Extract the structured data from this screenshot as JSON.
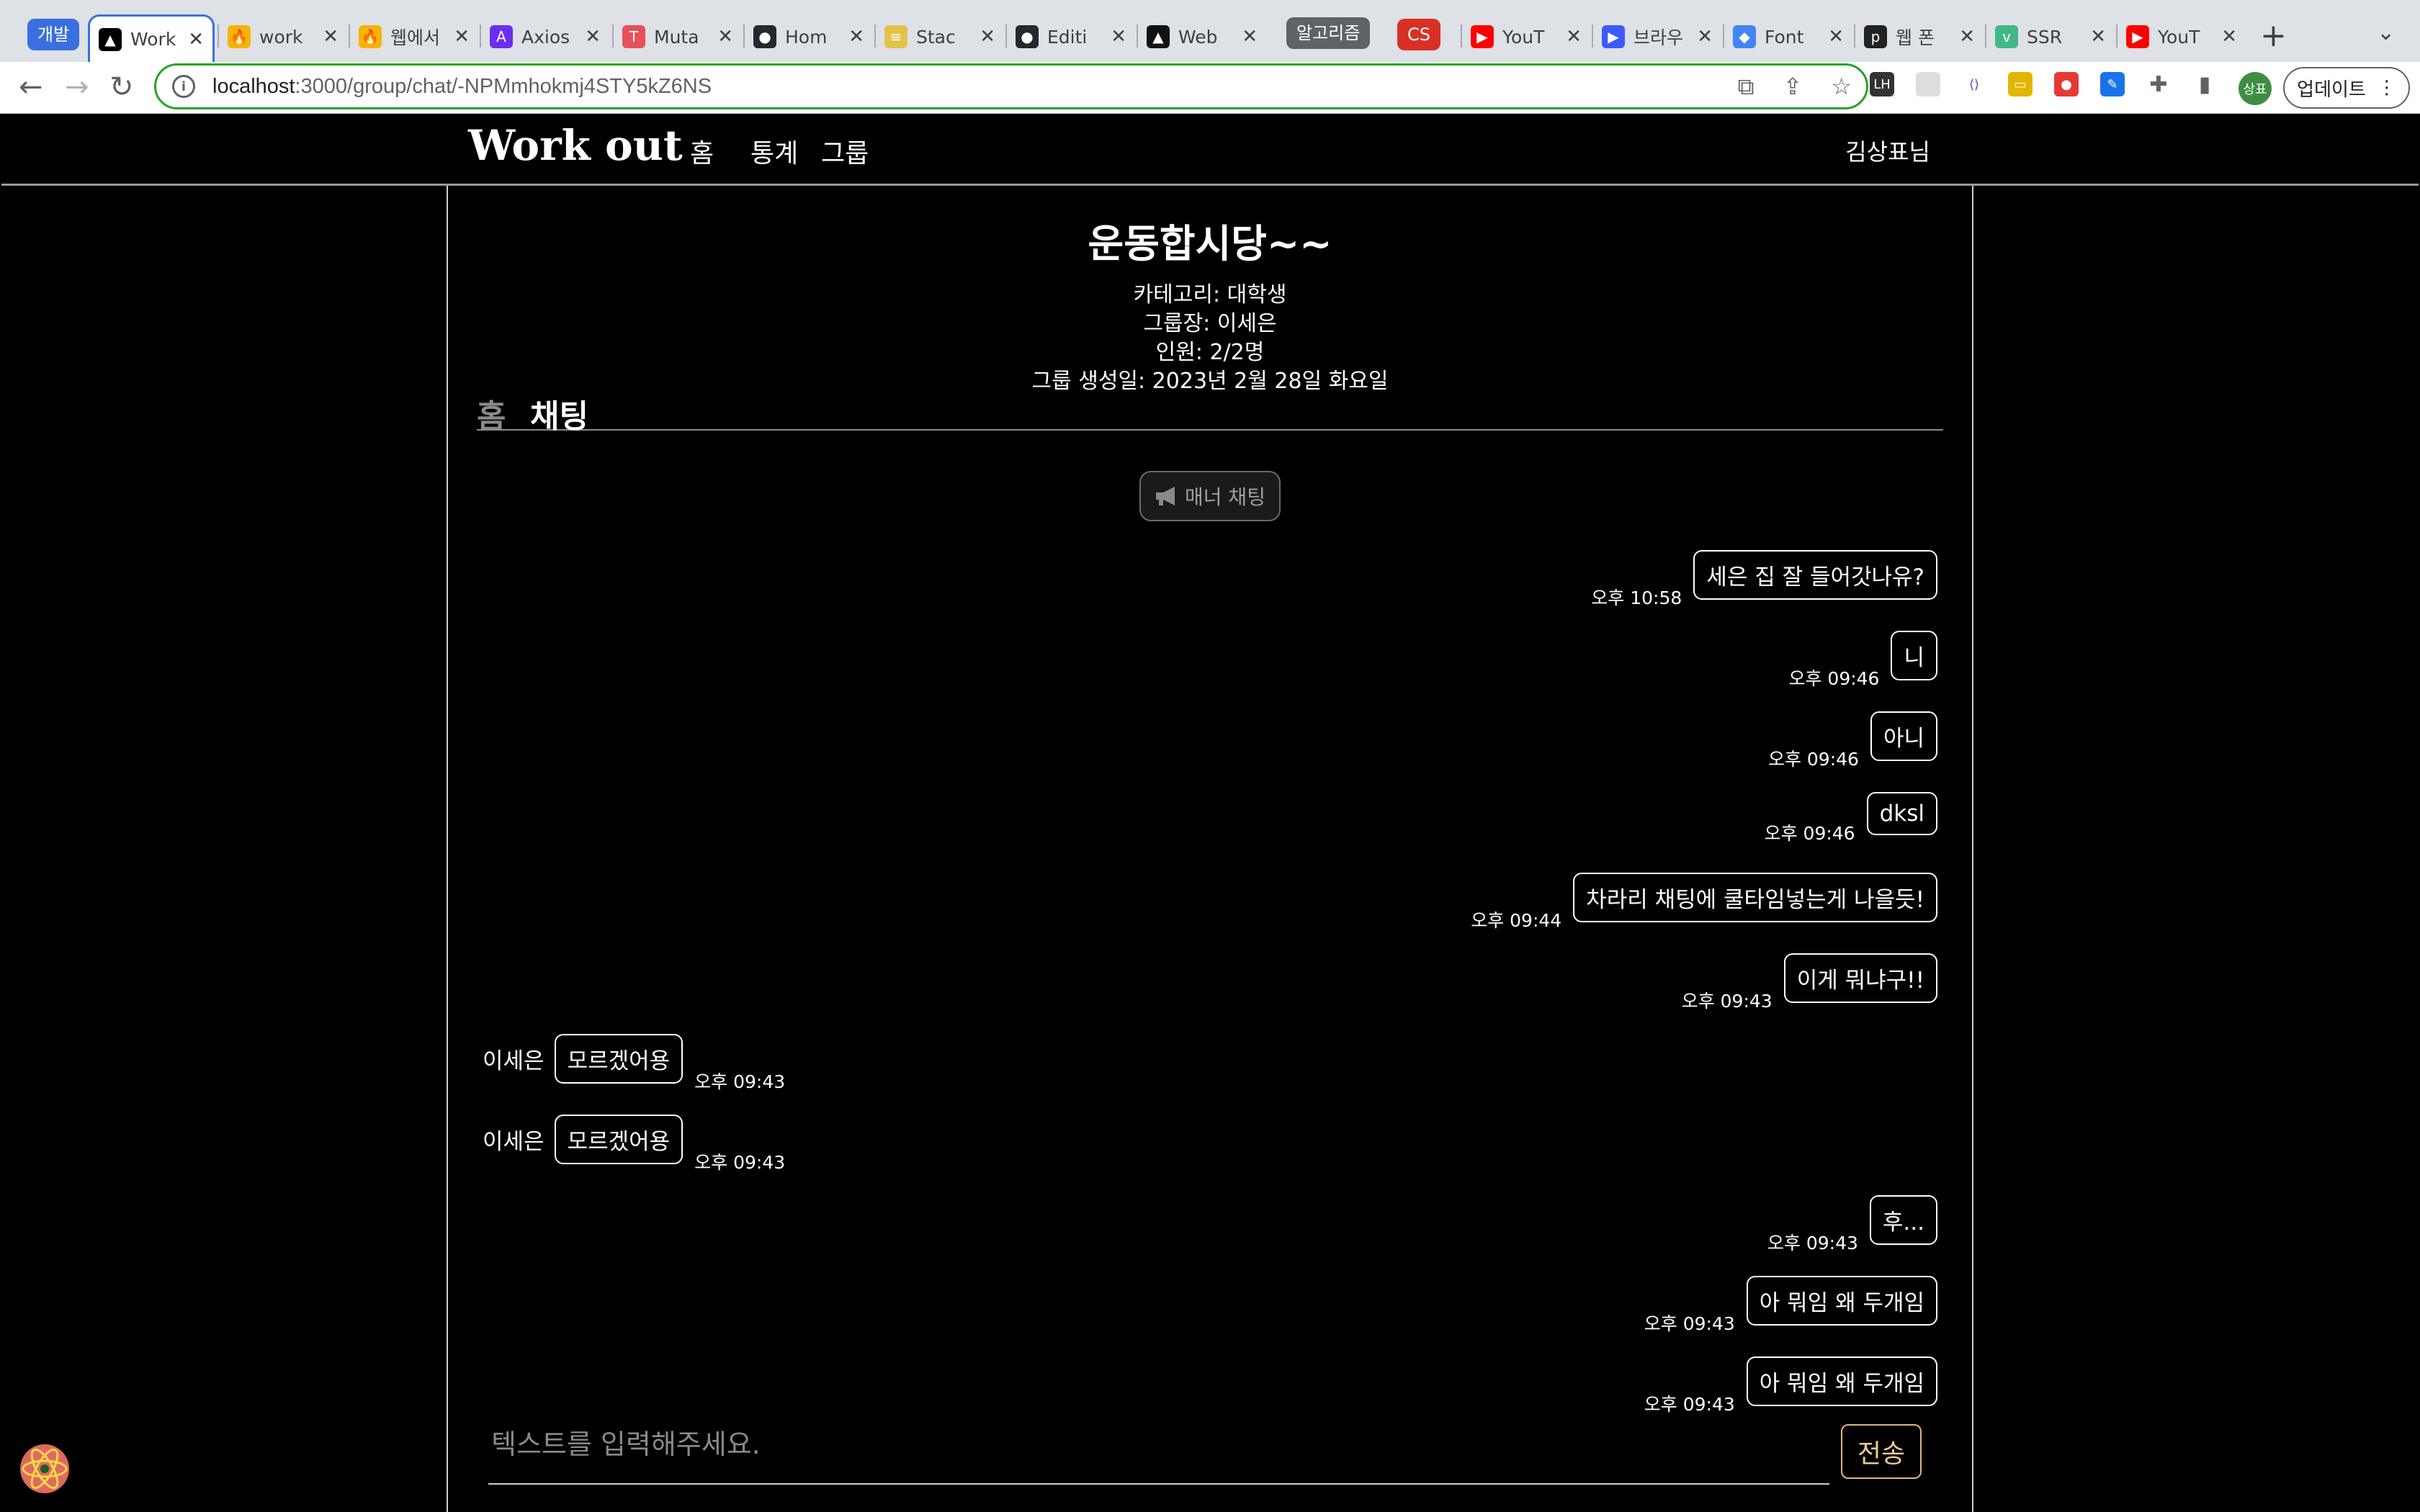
{
  "browser": {
    "tab_groups": [
      {
        "label": "개발",
        "color": "#3b6fe0"
      },
      {
        "label": "알고리즘",
        "color": "#5f6368"
      },
      {
        "label": "CS",
        "color": "#d93025"
      }
    ],
    "tabs": [
      {
        "title": "Work",
        "favicon_color": "#000000",
        "favicon": "▲"
      },
      {
        "title": "work",
        "favicon_color": "#f5b400",
        "favicon": "🔥"
      },
      {
        "title": "웹에서",
        "favicon_color": "#f5b400",
        "favicon": "🔥"
      },
      {
        "title": "Axios",
        "favicon_color": "#6b2ef0",
        "favicon": "A"
      },
      {
        "title": "Muta",
        "favicon_color": "#e8505b",
        "favicon": "T"
      },
      {
        "title": "Hom",
        "favicon_color": "#24292e",
        "favicon": "●"
      },
      {
        "title": "Stac",
        "favicon_color": "#e3c24a",
        "favicon": "≡"
      },
      {
        "title": "Editi",
        "favicon_color": "#24292e",
        "favicon": "●"
      },
      {
        "title": "Web",
        "favicon_color": "#111111",
        "favicon": "▲"
      },
      {
        "title": "YouT",
        "favicon_color": "#ff0000",
        "favicon": "▶"
      },
      {
        "title": "브라우",
        "favicon_color": "#3d5afe",
        "favicon": "▶"
      },
      {
        "title": "Font",
        "favicon_color": "#4285f4",
        "favicon": "◆"
      },
      {
        "title": "웹 폰",
        "favicon_color": "#222222",
        "favicon": "p"
      },
      {
        "title": "SSR",
        "favicon_color": "#41b883",
        "favicon": "v"
      },
      {
        "title": "YouT",
        "favicon_color": "#ff0000",
        "favicon": "▶"
      }
    ],
    "url_host": "localhost",
    "url_path": ":3000/group/chat/-NPMmhokmj4STY5kZ6NS",
    "profile_label": "상표",
    "update_label": "업데이트"
  },
  "site": {
    "brand": "Work out",
    "nav": [
      "홈",
      "통계",
      "그룹"
    ],
    "user": "김상표님"
  },
  "group": {
    "title": "운동합시당~~",
    "category": "카테고리: 대학생",
    "leader": "그룹장: 이세은",
    "members": "인원: 2/2명",
    "created": "그룹 생성일: 2023년 2월 28일 화요일"
  },
  "subtabs": {
    "home": "홈",
    "chat": "채팅"
  },
  "manner_button": "매너 채팅",
  "messages": [
    {
      "side": "mine",
      "text": "세은 집 잘 들어갓나유?",
      "time": "오후 10:58"
    },
    {
      "side": "mine",
      "text": "니",
      "time": "오후 09:46"
    },
    {
      "side": "mine",
      "text": "아니",
      "time": "오후 09:46"
    },
    {
      "side": "mine",
      "text": "dksl",
      "time": "오후 09:46"
    },
    {
      "side": "mine",
      "text": "차라리 채팅에 쿨타임넣는게 나을듯!",
      "time": "오후 09:44"
    },
    {
      "side": "mine",
      "text": "이게 뭐냐구!!",
      "time": "오후 09:43"
    },
    {
      "side": "theirs",
      "sender": "이세은",
      "text": "모르겠어용",
      "time": "오후 09:43"
    },
    {
      "side": "theirs",
      "sender": "이세은",
      "text": "모르겠어용",
      "time": "오후 09:43"
    },
    {
      "side": "mine",
      "text": "후...",
      "time": "오후 09:43"
    },
    {
      "side": "mine",
      "text": "아 뭐임 왜 두개임",
      "time": "오후 09:43"
    },
    {
      "side": "mine",
      "text": "아 뭐임 왜 두개임",
      "time": "오후 09:43"
    }
  ],
  "input": {
    "placeholder": "텍스트를 입력해주세요.",
    "value": ""
  },
  "send_label": "전송"
}
